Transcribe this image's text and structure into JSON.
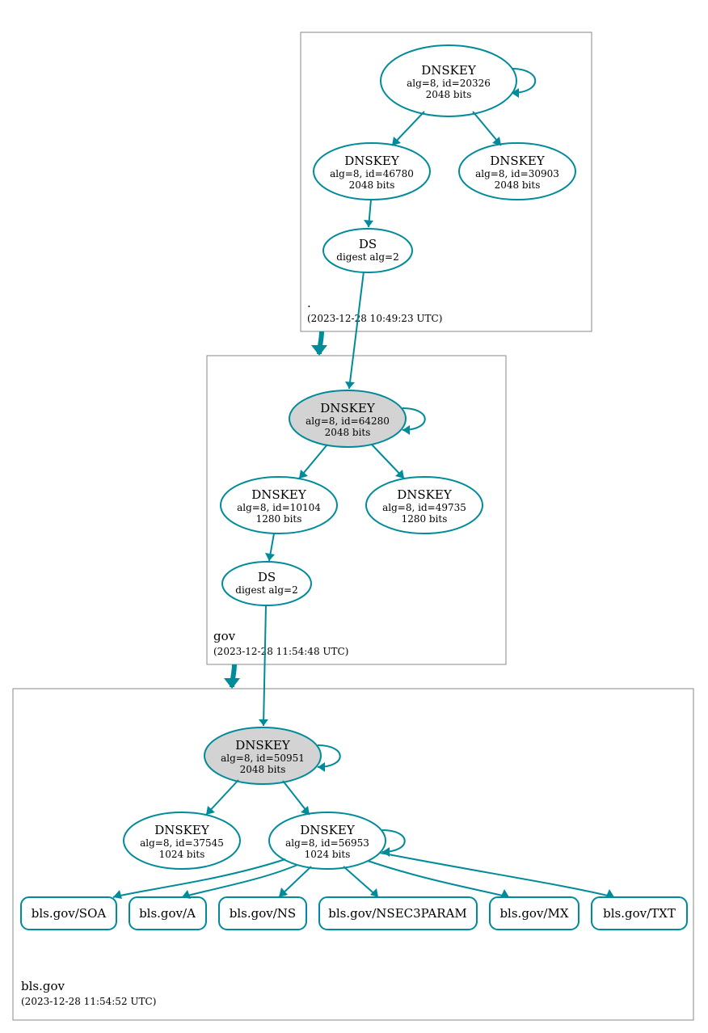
{
  "zone_root": {
    "label": ".",
    "timestamp": "(2023-12-28 10:49:23 UTC)",
    "ksk": {
      "title": "DNSKEY",
      "alg": "alg=8, id=20326",
      "bits": "2048 bits"
    },
    "zsk1": {
      "title": "DNSKEY",
      "alg": "alg=8, id=46780",
      "bits": "2048 bits"
    },
    "zsk2": {
      "title": "DNSKEY",
      "alg": "alg=8, id=30903",
      "bits": "2048 bits"
    },
    "ds": {
      "title": "DS",
      "alg": "digest alg=2"
    }
  },
  "zone_gov": {
    "label": "gov",
    "timestamp": "(2023-12-28 11:54:48 UTC)",
    "ksk": {
      "title": "DNSKEY",
      "alg": "alg=8, id=64280",
      "bits": "2048 bits"
    },
    "zsk1": {
      "title": "DNSKEY",
      "alg": "alg=8, id=10104",
      "bits": "1280 bits"
    },
    "zsk2": {
      "title": "DNSKEY",
      "alg": "alg=8, id=49735",
      "bits": "1280 bits"
    },
    "ds": {
      "title": "DS",
      "alg": "digest alg=2"
    }
  },
  "zone_bls": {
    "label": "bls.gov",
    "timestamp": "(2023-12-28 11:54:52 UTC)",
    "ksk": {
      "title": "DNSKEY",
      "alg": "alg=8, id=50951",
      "bits": "2048 bits"
    },
    "zsk1": {
      "title": "DNSKEY",
      "alg": "alg=8, id=37545",
      "bits": "1024 bits"
    },
    "zsk2": {
      "title": "DNSKEY",
      "alg": "alg=8, id=56953",
      "bits": "1024 bits"
    },
    "rr": {
      "soa": "bls.gov/SOA",
      "a": "bls.gov/A",
      "ns": "bls.gov/NS",
      "nsec3param": "bls.gov/NSEC3PARAM",
      "mx": "bls.gov/MX",
      "txt": "bls.gov/TXT"
    }
  }
}
